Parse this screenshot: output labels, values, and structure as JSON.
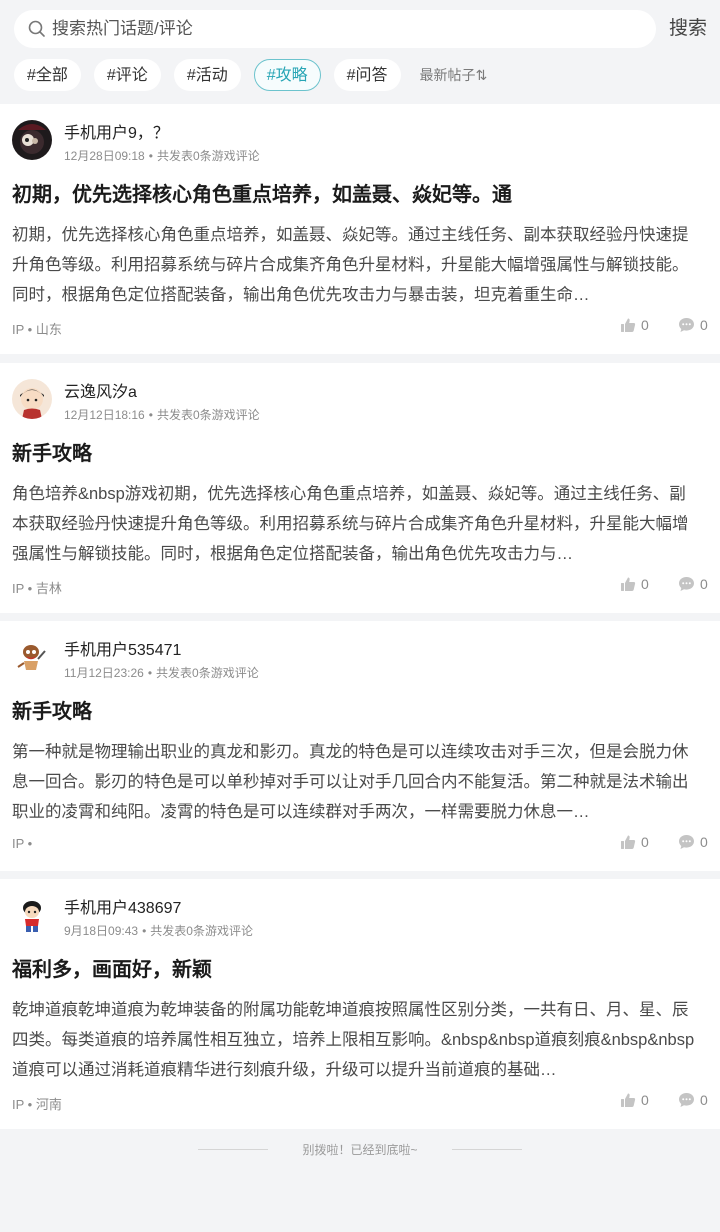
{
  "search": {
    "placeholder": "搜索热门话题/评论",
    "button_label": "搜索"
  },
  "tags": [
    "#全部",
    "#评论",
    "#活动",
    "#攻略",
    "#问答"
  ],
  "active_tag": "#攻略",
  "sort_label": "最新帖子⇅",
  "posts": [
    {
      "username": "手机用户9，？",
      "date": "12月28日09:18",
      "meta_suffix": "共发表0条游戏评论",
      "title": "初期，优先选择核心角色重点培养，如盖聂、焱妃等。通",
      "body": "初期，优先选择核心角色重点培养，如盖聂、焱妃等。通过主线任务、副本获取经验丹快速提升角色等级。利用招募系统与碎片合成集齐角色升星材料，升星能大幅增强属性与解锁技能。同时，根据角色定位搭配装备，输出角色优先攻击力与暴击装，坦克着重生命…",
      "ip": "IP • 山东",
      "likes": "0",
      "comments": "0"
    },
    {
      "username": "云逸风汐a",
      "date": "12月12日18:16",
      "meta_suffix": "共发表0条游戏评论",
      "title": "新手攻略",
      "body": "角色培养&nbsp游戏初期，优先选择核心角色重点培养，如盖聂、焱妃等。通过主线任务、副本获取经验丹快速提升角色等级。利用招募系统与碎片合成集齐角色升星材料，升星能大幅增强属性与解锁技能。同时，根据角色定位搭配装备，输出角色优先攻击力与…",
      "ip": "IP • 吉林",
      "likes": "0",
      "comments": "0"
    },
    {
      "username": "手机用户535471",
      "date": "11月12日23:26",
      "meta_suffix": "共发表0条游戏评论",
      "title": "新手攻略",
      "body": "第一种就是物理输出职业的真龙和影刃。真龙的特色是可以连续攻击对手三次，但是会脱力休息一回合。影刃的特色是可以单秒掉对手可以让对手几回合内不能复活。第二种就是法术输出职业的凌霄和纯阳。凌霄的特色是可以连续群对手两次，一样需要脱力休息一…",
      "ip": "IP •",
      "likes": "0",
      "comments": "0"
    },
    {
      "username": "手机用户438697",
      "date": "9月18日09:43",
      "meta_suffix": "共发表0条游戏评论",
      "title": "福利多，画面好，新颖",
      "body": "乾坤道痕乾坤道痕为乾坤装备的附属功能乾坤道痕按照属性区别分类，一共有日、月、星、辰四类。每类道痕的培养属性相互独立，培养上限相互影响。&nbsp&nbsp道痕刻痕&nbsp&nbsp道痕可以通过消耗道痕精华进行刻痕升级，升级可以提升当前道痕的基础…",
      "ip": "IP • 河南",
      "likes": "0",
      "comments": "0"
    }
  ],
  "footer_text": "别拨啦！已经到底啦~",
  "colors": {
    "accent": "#27a5b5",
    "background": "#f3f4f6",
    "card": "#ffffff"
  }
}
